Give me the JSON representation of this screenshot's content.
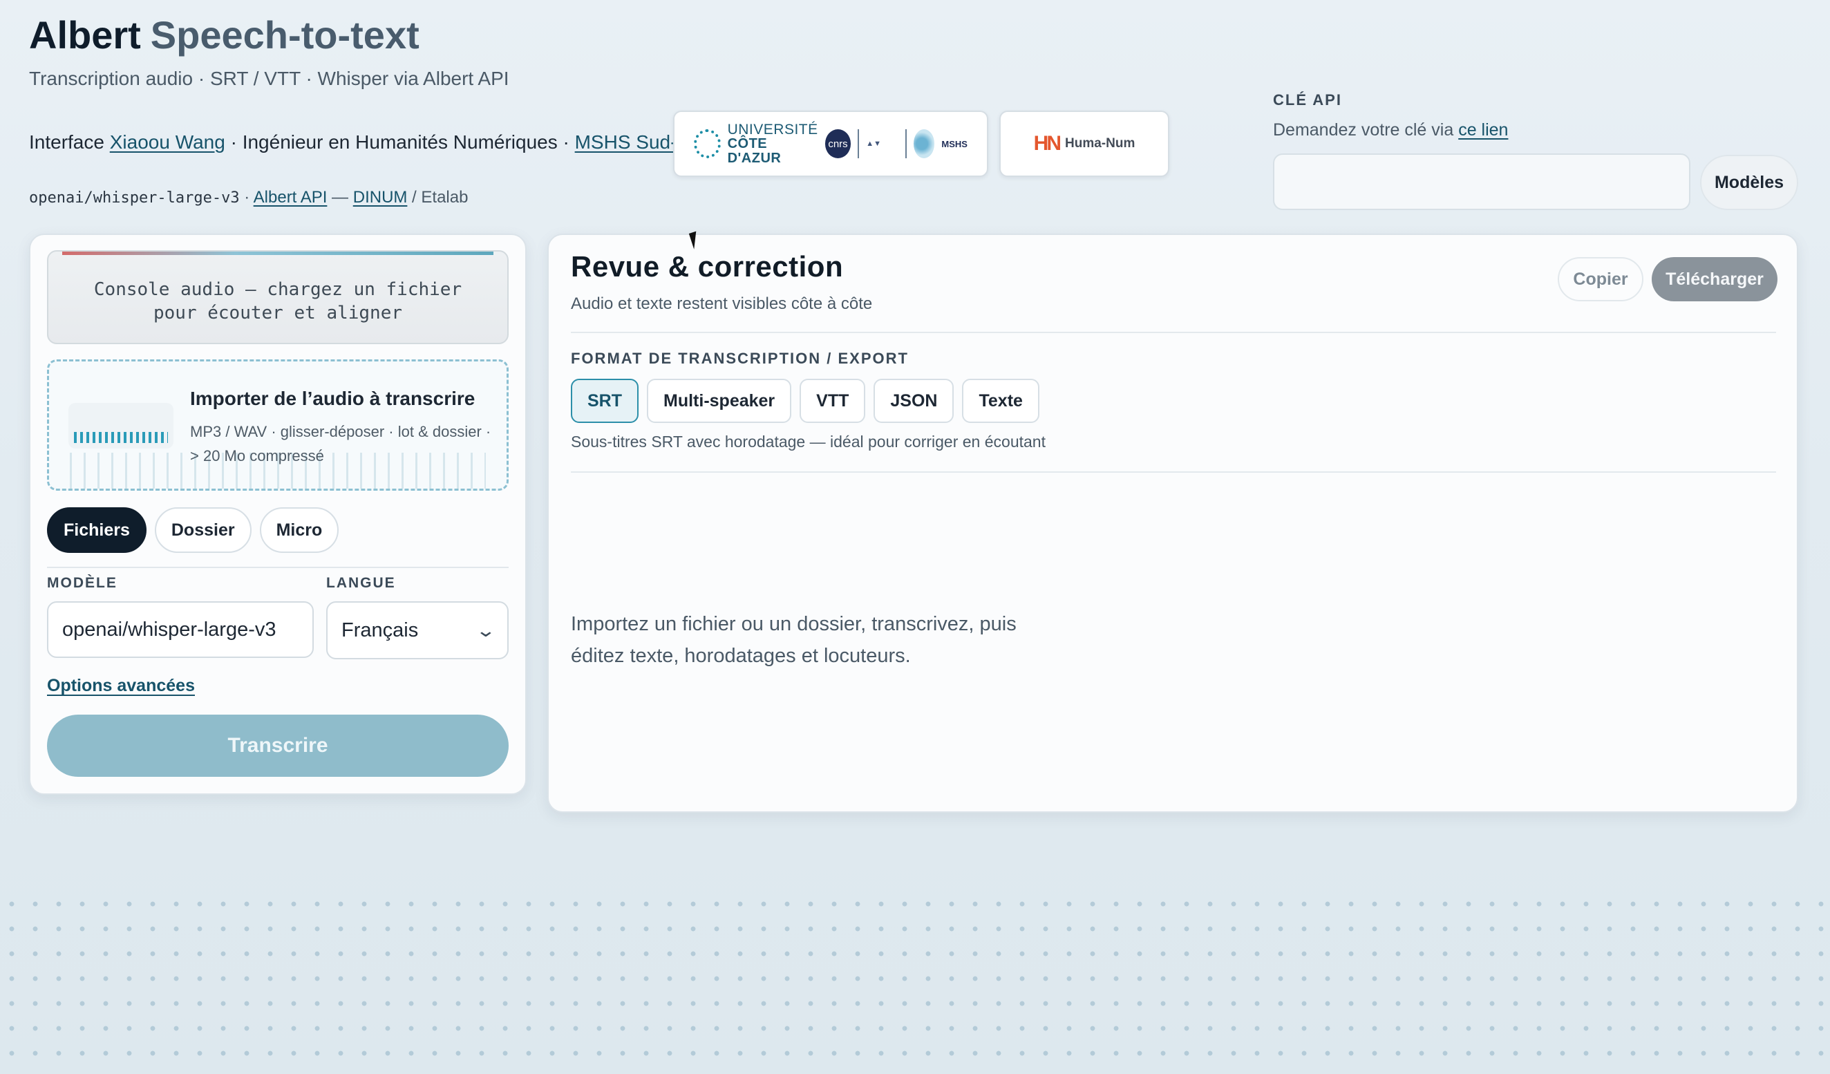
{
  "header": {
    "brand": "Albert",
    "app_name": "Speech-to-text",
    "subtitle": "Transcription audio · SRT / VTT · Whisper via Albert API",
    "credit_prefix": "Interface ",
    "credit_author": "Xiaoou Wang",
    "credit_role": " · Ingénieur en Humanités Numériques · ",
    "credit_lab": "MSHS Sud-Est",
    "model_mono": "openai/whisper-large-v3",
    "model_sep": " · ",
    "albert_api_link": "Albert API",
    "dash": " — ",
    "dinum_link": "DINUM",
    "etalab_suffix": " / Etalab"
  },
  "logos": {
    "uca_line1": "UNIVERSITÉ",
    "uca_line2": "CÔTE D'AZUR",
    "cnrs": "cnrs",
    "mshs": "MSHS",
    "humanum_mark": "HN",
    "humanum_text": "Huma-Num"
  },
  "api": {
    "label": "CLÉ API",
    "hint_prefix": "Demandez votre clé via ",
    "hint_link": "ce lien",
    "key_value": "",
    "models_button": "Modèles"
  },
  "left_panel": {
    "console_line1": "Console audio — chargez un fichier",
    "console_line2": "pour écouter et aligner",
    "drop_title": "Importer de l’audio à transcrire",
    "drop_desc": "MP3 / WAV · glisser-déposer · lot & dossier · > 20 Mo compressé",
    "source_tabs": [
      "Fichiers",
      "Dossier",
      "Micro"
    ],
    "active_source": "Fichiers",
    "model_label": "MODÈLE",
    "model_value": "openai/whisper-large-v3",
    "language_label": "LANGUE",
    "language_value": "Français",
    "advanced_link": "Options avancées",
    "transcribe_button": "Transcrire"
  },
  "right_panel": {
    "title": "Revue & correction",
    "subtitle": "Audio et texte restent visibles côte à côte",
    "copy_button": "Copier",
    "download_button": "Télécharger",
    "format_label": "FORMAT DE TRANSCRIPTION / EXPORT",
    "formats": [
      "SRT",
      "Multi-speaker",
      "VTT",
      "JSON",
      "Texte"
    ],
    "active_format": "SRT",
    "format_desc": "Sous-titres SRT avec horodatage — idéal pour corriger en écoutant",
    "empty_state": "Importez un fichier ou un dossier, transcrivez, puis éditez texte, horodatages et locuteurs."
  }
}
